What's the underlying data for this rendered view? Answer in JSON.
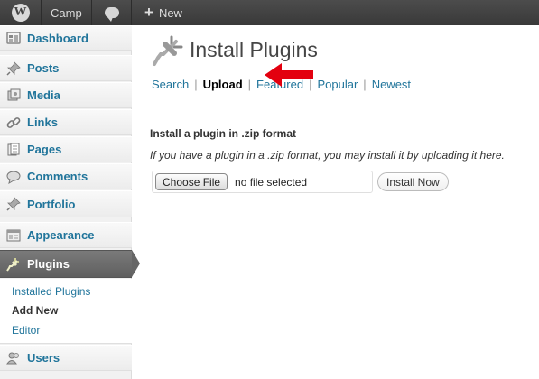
{
  "admin_bar": {
    "logo_icon": "wordpress-logo-icon",
    "site_name": "Camp",
    "comments_icon": "comment-bubble-icon",
    "new_label": "New"
  },
  "sidebar": {
    "items": [
      {
        "label": "Dashboard",
        "icon": "dashboard-icon"
      },
      {
        "label": "Posts",
        "icon": "pushpin-icon"
      },
      {
        "label": "Media",
        "icon": "media-icon"
      },
      {
        "label": "Links",
        "icon": "link-icon"
      },
      {
        "label": "Pages",
        "icon": "pages-icon"
      },
      {
        "label": "Comments",
        "icon": "comments-icon"
      },
      {
        "label": "Portfolio",
        "icon": "pushpin-icon"
      },
      {
        "label": "Appearance",
        "icon": "appearance-icon"
      },
      {
        "label": "Plugins",
        "icon": "plug-icon",
        "current": true
      },
      {
        "label": "Users",
        "icon": "users-icon"
      }
    ],
    "plugins_submenu": [
      {
        "label": "Installed Plugins"
      },
      {
        "label": "Add New",
        "current": true
      },
      {
        "label": "Editor"
      }
    ]
  },
  "page": {
    "title": "Install Plugins",
    "title_icon": "plugin-icon",
    "tabs": [
      {
        "label": "Search"
      },
      {
        "label": "Upload",
        "current": true
      },
      {
        "label": "Featured"
      },
      {
        "label": "Popular"
      },
      {
        "label": "Newest"
      }
    ],
    "upload_heading": "Install a plugin in .zip format",
    "upload_description": "If you have a plugin in a .zip format, you may install it by uploading it here.",
    "choose_file_label": "Choose File",
    "file_status": "no file selected",
    "install_button_label": "Install Now"
  },
  "annotation": {
    "icon": "red-arrow-icon",
    "color": "#e3000f"
  },
  "colors": {
    "link": "#21759b",
    "admin_bar": "#464646",
    "sidebar_bg": "#f1f1f1",
    "current_menu": "#6d6d6d"
  }
}
